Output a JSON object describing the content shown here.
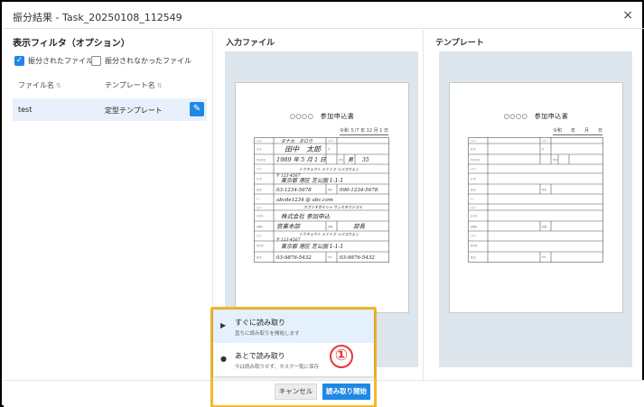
{
  "dialog": {
    "title": "振分結果 - Task_20250108_112549",
    "close_glyph": "×"
  },
  "filter": {
    "title": "表示フィルタ（オプション）",
    "sorted_label": "振分されたファイル",
    "sorted_checked": true,
    "unsorted_label": "振分されなかったファイル",
    "unsorted_checked": false
  },
  "table": {
    "columns": [
      "ファイル名",
      "テンプレート名"
    ],
    "sort_glyph": "⇅",
    "rows": [
      {
        "file": "test",
        "template": "定型テンプレート"
      }
    ]
  },
  "panes": {
    "input_title": "入力ファイル",
    "template_title": "テンプレート"
  },
  "document": {
    "heading": "○○○○　参加申込書",
    "date_written": "令和 ５/7 年 12 月 1 日",
    "date_blank": "令和　　年　　月　　日",
    "handwriting": {
      "name_kana": "タナカ　タロウ",
      "name": "田中　太郎",
      "birth": "1989 年 5 月 1 日",
      "gender": "男",
      "age": "35",
      "address_kana": "トウキョウト ミナトク シバコウエン",
      "postal": "〒 123-4567",
      "address": "東京都 港区 芝公園 1-1-1",
      "phone": "03-1234-5678",
      "mobile": "090-1234-5678",
      "email": "abcde1234 @ abc.com",
      "company_kana": "カブシキガイシャ サンカモウシコミ",
      "company": "株式会社 参加申込",
      "dept": "営業本部",
      "position": "部長",
      "company_address_kana": "トウキョウト ミナトク シバコウエン",
      "company_postal": "〒 123-4567",
      "company_address": "東京都 港区 芝公園 1-1-1",
      "company_phone": "03-9876-5432",
      "company_fax": "03-9876-5432"
    }
  },
  "menu": {
    "items": [
      {
        "label": "すぐに読み取り",
        "sub": "直ちに読み取りを開始します",
        "icon": "play-icon"
      },
      {
        "label": "あとで読み取り",
        "sub": "今は読み取りせず、タスク一覧に保存",
        "icon": "clock-icon"
      }
    ]
  },
  "annotation": {
    "marker": "①",
    "color": "#e53935",
    "highlight": "#f5b82e"
  },
  "footer": {
    "cancel_label": "キャンセル",
    "start_label": "読み取り開始"
  },
  "colors": {
    "primary": "#1e88e5",
    "selected_row": "#e8f1fb",
    "pane_bg": "#dde5ed"
  }
}
